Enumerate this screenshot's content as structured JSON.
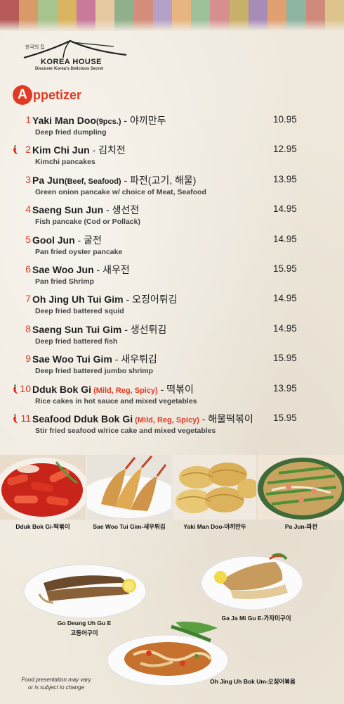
{
  "header": {
    "stripe_colors": [
      "#b85a58",
      "#d99a6a",
      "#a7c48c",
      "#d9b45f",
      "#c97a9a",
      "#e6c9a0",
      "#8fb08a",
      "#d48d79",
      "#b5a0c8",
      "#e8b580",
      "#9cc09a",
      "#d68f8f",
      "#c9b06a",
      "#a88cb8",
      "#e0a070",
      "#8cb4a0",
      "#cf8a7c",
      "#dcc48c"
    ]
  },
  "logo": {
    "korean": "한국의 집",
    "name": "KOREA HOUSE",
    "tagline": "Discover Korea's Delicious Secret"
  },
  "section": {
    "letter": "A",
    "rest": "ppetizer",
    "accent": "#e03a24"
  },
  "items": [
    {
      "num": "1",
      "name": "Yaki Man Doo",
      "extra": "(9pcs.)",
      "spicy": "",
      "ko": " - 야끼만두",
      "desc": "Deep fried dumpling",
      "price": "10.95",
      "pepper": false
    },
    {
      "num": "2",
      "name": "Kim Chi Jun",
      "extra": "",
      "spicy": "",
      "ko": " - 김치전",
      "desc": "Kimchi pancakes",
      "price": "12.95",
      "pepper": true
    },
    {
      "num": "3",
      "name": "Pa Jun",
      "extra": "(Beef, Seafood)",
      "spicy": "",
      "ko": " - 파전(고기, 해물)",
      "desc": "Green onion pancake w/ choice of Meat, Seafood",
      "price": "13.95",
      "pepper": false
    },
    {
      "num": "4",
      "name": "Saeng Sun Jun",
      "extra": "",
      "spicy": "",
      "ko": " - 생선전",
      "desc": "Fish pancake (Cod or Pollack)",
      "price": "14.95",
      "pepper": false
    },
    {
      "num": "5",
      "name": "Gool Jun",
      "extra": "",
      "spicy": "",
      "ko": " - 굴전",
      "desc": "Pan fried oyster pancake",
      "price": "14.95",
      "pepper": false
    },
    {
      "num": "6",
      "name": "Sae Woo Jun",
      "extra": "",
      "spicy": "",
      "ko": " - 새우전",
      "desc": "Pan fried Shrimp",
      "price": "15.95",
      "pepper": false
    },
    {
      "num": "7",
      "name": "Oh Jing Uh Tui Gim",
      "extra": "",
      "spicy": "",
      "ko": " - 오징어튀김",
      "desc": "Deep fried battered squid",
      "price": "14.95",
      "pepper": false
    },
    {
      "num": "8",
      "name": "Saeng Sun Tui Gim",
      "extra": "",
      "spicy": "",
      "ko": " - 생선튀김",
      "desc": "Deep fried battered fish",
      "price": "14.95",
      "pepper": false
    },
    {
      "num": "9",
      "name": "Sae Woo Tui Gim",
      "extra": "",
      "spicy": "",
      "ko": " - 새우튀김",
      "desc": "Deep fried battered jumbo shrimp",
      "price": "15.95",
      "pepper": false
    },
    {
      "num": "10",
      "name": "Dduk Bok Gi",
      "extra": "",
      "spicy": " (Mild, Reg, Spicy)",
      "ko": " - 떡볶이",
      "desc": "Rice cakes in hot sauce and mixed vegetables",
      "price": "13.95",
      "pepper": true
    },
    {
      "num": "11",
      "name": "Seafood Dduk Bok Gi",
      "extra": "",
      "spicy": " (Mild, Reg, Spicy)",
      "ko": " - 해물떡볶이",
      "desc": "Stir fried seafood w/rice cake and mixed vegetables",
      "price": "15.95",
      "pepper": true
    }
  ],
  "photos": {
    "top_captions": [
      "Dduk Bok Gi-떡볶이",
      "Sae Woo Tui Gim-새우튀김",
      "Yaki Man Doo-야끼만두",
      "Pa Jun-파전"
    ],
    "mackerel_name": "Go Deung Uh Gu E",
    "mackerel_ko": "고등어구이",
    "flatfish": "Ga Ja Mi Gu E-가자미구이",
    "squid": "Oh Jing Uh Bok Um-오징어볶음"
  },
  "note": {
    "line1": "Food presentation may vary",
    "line2": "or is subject to change"
  }
}
